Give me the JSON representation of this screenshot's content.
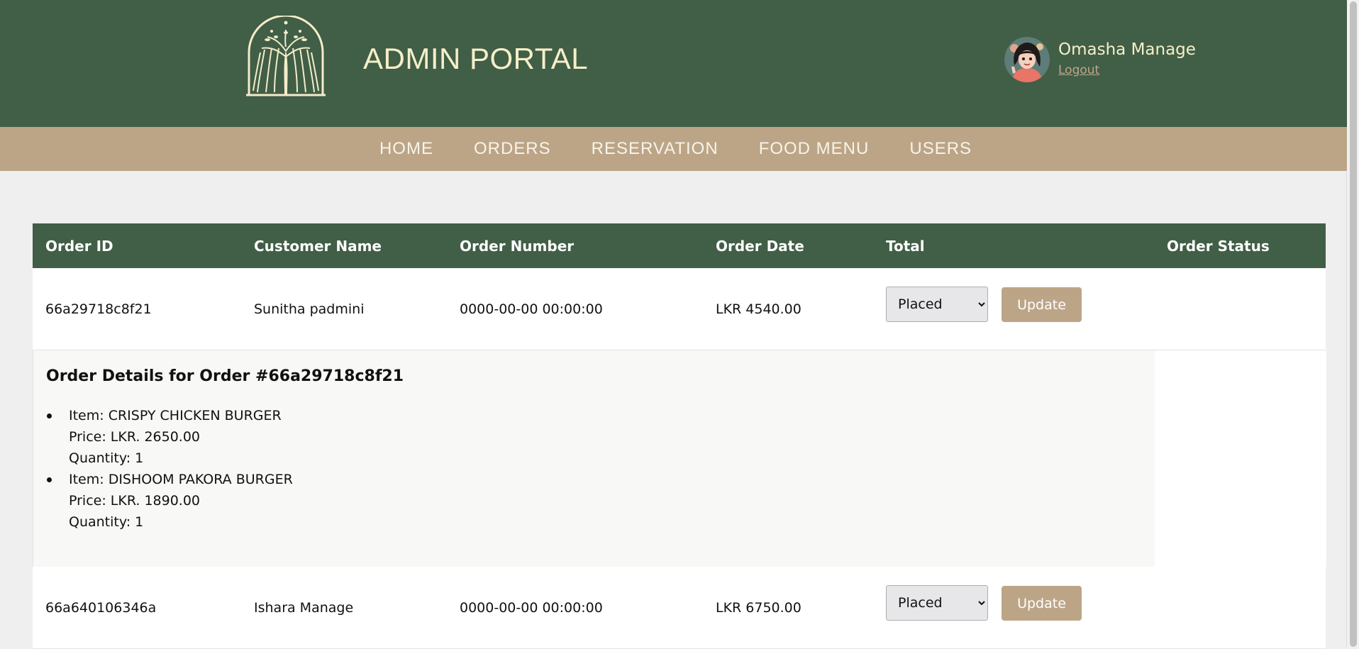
{
  "header": {
    "title": "ADMIN PORTAL",
    "user_name": "Omasha Manage",
    "logout_label": "Logout",
    "bg_color": "#415e46",
    "accent_color": "#bca587"
  },
  "nav": {
    "items": [
      {
        "label": "HOME"
      },
      {
        "label": "ORDERS"
      },
      {
        "label": "RESERVATION"
      },
      {
        "label": "FOOD MENU"
      },
      {
        "label": "USERS"
      }
    ]
  },
  "table": {
    "headers": [
      "Order ID",
      "Customer Name",
      "Order Number",
      "Order Date",
      "Total",
      "Order Status"
    ],
    "rows": [
      {
        "order_id": "66a29718c8f21",
        "customer": "Sunitha padmini",
        "order_number": "0000-00-00 00:00:00",
        "order_date": "LKR 4540.00",
        "status": "Placed",
        "update_label": "Update",
        "details_title": "Order Details for Order #66a29718c8f21",
        "items": [
          {
            "item": "Item: CRISPY CHICKEN BURGER",
            "price": "Price: LKR. 2650.00",
            "quantity": "Quantity: 1"
          },
          {
            "item": "Item: DISHOOM PAKORA BURGER",
            "price": "Price: LKR. 1890.00",
            "quantity": "Quantity: 1"
          }
        ]
      },
      {
        "order_id": "66a640106346a",
        "customer": "Ishara Manage",
        "order_number": "0000-00-00 00:00:00",
        "order_date": "LKR 6750.00",
        "status": "Placed",
        "update_label": "Update"
      }
    ]
  }
}
